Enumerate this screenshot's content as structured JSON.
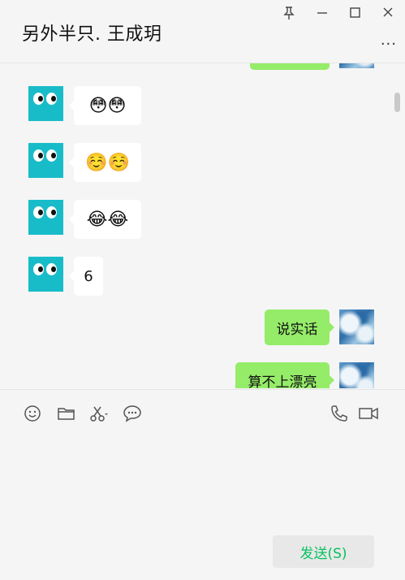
{
  "header": {
    "title": "另外半只. 王成玥",
    "more_label": "···"
  },
  "window_controls": [
    "pin-icon",
    "minimize-icon",
    "maximize-icon",
    "close-icon"
  ],
  "messages": [
    {
      "from": "contact",
      "text": "😳😳",
      "type": "emoji"
    },
    {
      "from": "contact",
      "text": "☺️☺️",
      "type": "emoji"
    },
    {
      "from": "contact",
      "text": "😂😂",
      "type": "emoji"
    },
    {
      "from": "contact",
      "text": "6",
      "type": "text"
    },
    {
      "from": "me",
      "text": "说实话",
      "type": "text"
    },
    {
      "from": "me",
      "text": "算不上漂亮",
      "type": "text"
    }
  ],
  "toolbar": {
    "icons": [
      "emoji-icon",
      "folder-icon",
      "scissors-icon",
      "chat-bubble-icon",
      "phone-icon",
      "video-call-icon"
    ]
  },
  "send_button": {
    "label": "发送(S)"
  },
  "colors": {
    "self_bubble": "#95ec69",
    "contact_bubble": "#ffffff",
    "send_text": "#07c160",
    "robot_avatar": "#18bcc8"
  }
}
